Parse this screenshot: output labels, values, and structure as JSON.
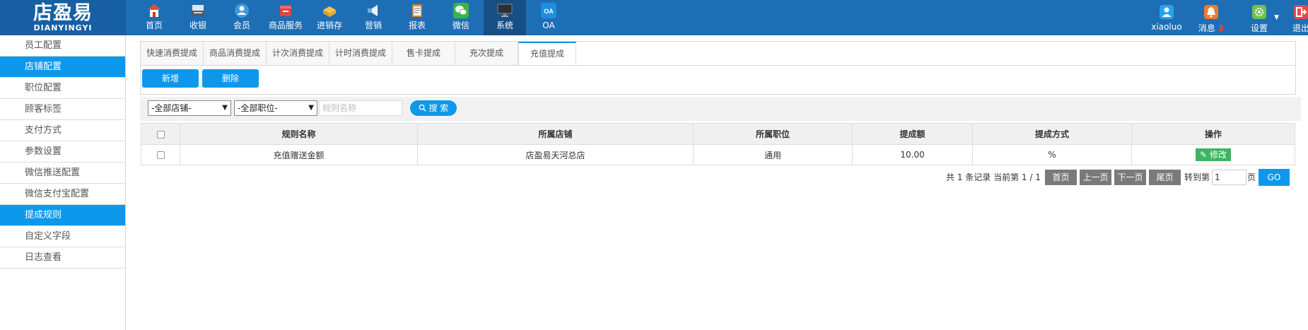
{
  "brand": {
    "name_cn": "店盈易",
    "name_en": "DIANYINGYI"
  },
  "nav": [
    {
      "label": "首页",
      "icon": "home-icon",
      "color": "#e94b3c"
    },
    {
      "label": "收银",
      "icon": "cash-register-icon",
      "color": "#4d5b6b"
    },
    {
      "label": "会员",
      "icon": "member-icon",
      "color": "#3a9bd8"
    },
    {
      "label": "商品服务",
      "icon": "goods-icon",
      "color": "#e0463e"
    },
    {
      "label": "进销存",
      "icon": "inventory-icon",
      "color": "#e9a93a"
    },
    {
      "label": "营销",
      "icon": "megaphone-icon",
      "color": "#6ab0e8"
    },
    {
      "label": "报表",
      "icon": "report-icon",
      "color": "#c98a3e"
    },
    {
      "label": "微信",
      "icon": "wechat-icon",
      "color": "#3cb34a"
    },
    {
      "label": "系统",
      "icon": "monitor-icon",
      "color": "#2b2f36"
    },
    {
      "label": "OA",
      "icon": "oa-icon",
      "color": "#1e8fe0"
    }
  ],
  "user": {
    "name": "xiaoluo",
    "messages_label": "消息",
    "messages_count": "3",
    "settings_label": "设置",
    "logout_label": "退出"
  },
  "sidebar": [
    "员工配置",
    "店铺配置",
    "职位配置",
    "顾客标签",
    "支付方式",
    "参数设置",
    "微信推送配置",
    "微信支付宝配置",
    "提成规则",
    "自定义字段",
    "日志查看"
  ],
  "tabs": [
    "快速消费提成",
    "商品消费提成",
    "计次消费提成",
    "计时消费提成",
    "售卡提成",
    "充次提成",
    "充值提成"
  ],
  "actions": {
    "add": "新增",
    "delete": "删除"
  },
  "filters": {
    "store": "-全部店铺-",
    "position": "-全部职位-",
    "name_placeholder": "规则名称",
    "search": "搜 索"
  },
  "table": {
    "headers": [
      "规则名称",
      "所属店铺",
      "所属职位",
      "提成额",
      "提成方式",
      "操作"
    ],
    "rows": [
      {
        "name": "充值赠送金额",
        "store": "店盈易天河总店",
        "position": "通用",
        "amount": "10.00",
        "method": "%",
        "action": "修改"
      }
    ]
  },
  "pager": {
    "summary": "共 1 条记录 当前第 1 / 1",
    "first": "首页",
    "prev": "上一页",
    "next": "下一页",
    "last": "尾页",
    "goto": "转到第",
    "page_value": "1",
    "page_unit": "页",
    "go": "GO"
  }
}
